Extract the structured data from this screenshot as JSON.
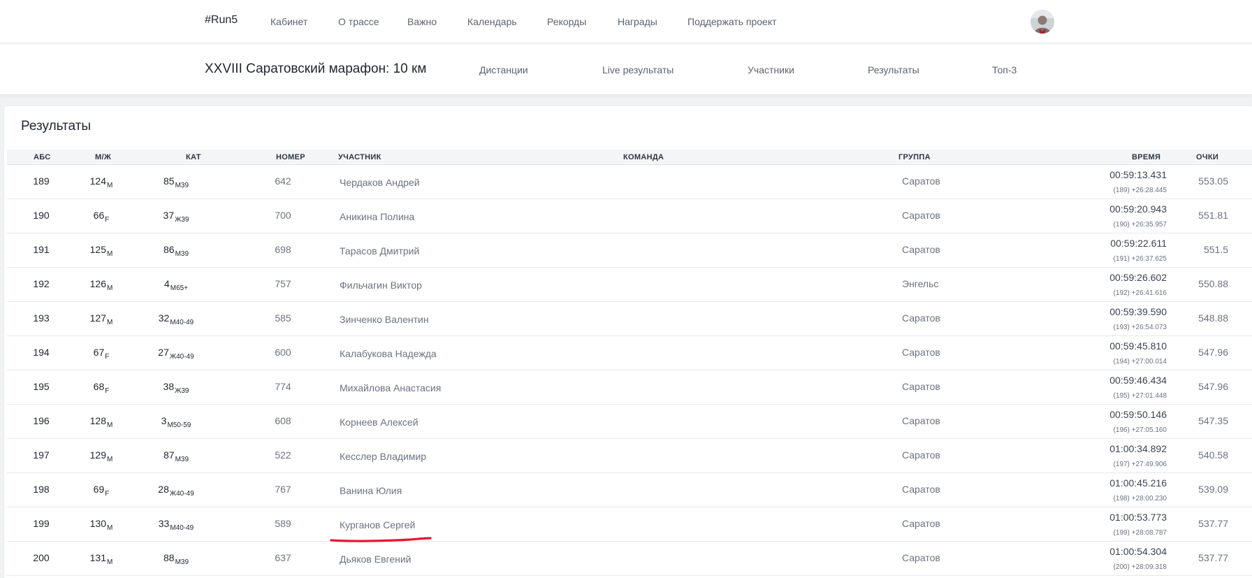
{
  "topnav": {
    "brand": "#Run5",
    "items": [
      "Кабинет",
      "О трассе",
      "Важно",
      "Календарь",
      "Рекорды",
      "Награды",
      "Поддержать проект"
    ]
  },
  "subnav": {
    "event_title": "XXVIII Саратовский марафон: 10 км",
    "items": [
      "Дистанции",
      "Live результаты",
      "Участники",
      "Результаты",
      "Топ-3"
    ]
  },
  "results": {
    "title": "Результаты",
    "columns": [
      "АБС",
      "М/Ж",
      "КАТ",
      "НОМЕР",
      "УЧАСТНИК",
      "КОМАНДА",
      "ГРУППА",
      "ВРЕМЯ",
      "ОЧКИ"
    ],
    "rows": [
      {
        "abs": "189",
        "mf": "124",
        "mf_sub": "M",
        "cat": "85",
        "cat_sub": "M39",
        "bib": "642",
        "name": "Чердаков Андрей",
        "team": "",
        "group": "Саратов",
        "time": "00:59:13.431",
        "gap": "(189) +26:28.445",
        "points": "553.05"
      },
      {
        "abs": "190",
        "mf": "66",
        "mf_sub": "F",
        "cat": "37",
        "cat_sub": "Ж39",
        "bib": "700",
        "name": "Аникина Полина",
        "team": "",
        "group": "Саратов",
        "time": "00:59:20.943",
        "gap": "(190) +26:35.957",
        "points": "551.81"
      },
      {
        "abs": "191",
        "mf": "125",
        "mf_sub": "M",
        "cat": "86",
        "cat_sub": "M39",
        "bib": "698",
        "name": "Тарасов Дмитрий",
        "team": "",
        "group": "Саратов",
        "time": "00:59:22.611",
        "gap": "(191) +26:37.625",
        "points": "551.5"
      },
      {
        "abs": "192",
        "mf": "126",
        "mf_sub": "M",
        "cat": "4",
        "cat_sub": "M65+",
        "bib": "757",
        "name": "Фильчагин Виктор",
        "team": "",
        "group": "Энгельс",
        "time": "00:59:26.602",
        "gap": "(192) +26:41.616",
        "points": "550.88"
      },
      {
        "abs": "193",
        "mf": "127",
        "mf_sub": "M",
        "cat": "32",
        "cat_sub": "M40-49",
        "bib": "585",
        "name": "Зинченко Валентин",
        "team": "",
        "group": "Саратов",
        "time": "00:59:39.590",
        "gap": "(193) +26:54.073",
        "points": "548.88"
      },
      {
        "abs": "194",
        "mf": "67",
        "mf_sub": "F",
        "cat": "27",
        "cat_sub": "Ж40-49",
        "bib": "600",
        "name": "Калабукова Надежда",
        "team": "",
        "group": "Саратов",
        "time": "00:59:45.810",
        "gap": "(194) +27:00.014",
        "points": "547.96"
      },
      {
        "abs": "195",
        "mf": "68",
        "mf_sub": "F",
        "cat": "38",
        "cat_sub": "Ж39",
        "bib": "774",
        "name": "Михайлова Анастасия",
        "team": "",
        "group": "Саратов",
        "time": "00:59:46.434",
        "gap": "(195) +27:01.448",
        "points": "547.96"
      },
      {
        "abs": "196",
        "mf": "128",
        "mf_sub": "M",
        "cat": "3",
        "cat_sub": "M50-59",
        "bib": "608",
        "name": "Корнеев Алексей",
        "team": "",
        "group": "Саратов",
        "time": "00:59:50.146",
        "gap": "(196) +27:05.160",
        "points": "547.35"
      },
      {
        "abs": "197",
        "mf": "129",
        "mf_sub": "M",
        "cat": "87",
        "cat_sub": "M39",
        "bib": "522",
        "name": "Кесслер Владимир",
        "team": "",
        "group": "Саратов",
        "time": "01:00:34.892",
        "gap": "(197) +27:49.906",
        "points": "540.58"
      },
      {
        "abs": "198",
        "mf": "69",
        "mf_sub": "F",
        "cat": "28",
        "cat_sub": "Ж40-49",
        "bib": "767",
        "name": "Ванина Юлия",
        "team": "",
        "group": "Саратов",
        "time": "01:00:45.216",
        "gap": "(198) +28:00.230",
        "points": "539.09"
      },
      {
        "abs": "199",
        "mf": "130",
        "mf_sub": "M",
        "cat": "33",
        "cat_sub": "M40-49",
        "bib": "589",
        "name": "Курганов Сергей",
        "team": "",
        "group": "Саратов",
        "time": "01:00:53.773",
        "gap": "(199) +28:08.787",
        "points": "537.77"
      },
      {
        "abs": "200",
        "mf": "131",
        "mf_sub": "M",
        "cat": "88",
        "cat_sub": "M39",
        "bib": "637",
        "name": "Дьяков Евгений",
        "team": "",
        "group": "Саратов",
        "time": "01:00:54.304",
        "gap": "(200) +28:09.318",
        "points": "537.77"
      }
    ]
  },
  "colors": {
    "accent_underline": "#e8152f",
    "text_dark": "#1f2430",
    "text_muted": "#6b7280",
    "page_bg": "#f1f2f4"
  }
}
